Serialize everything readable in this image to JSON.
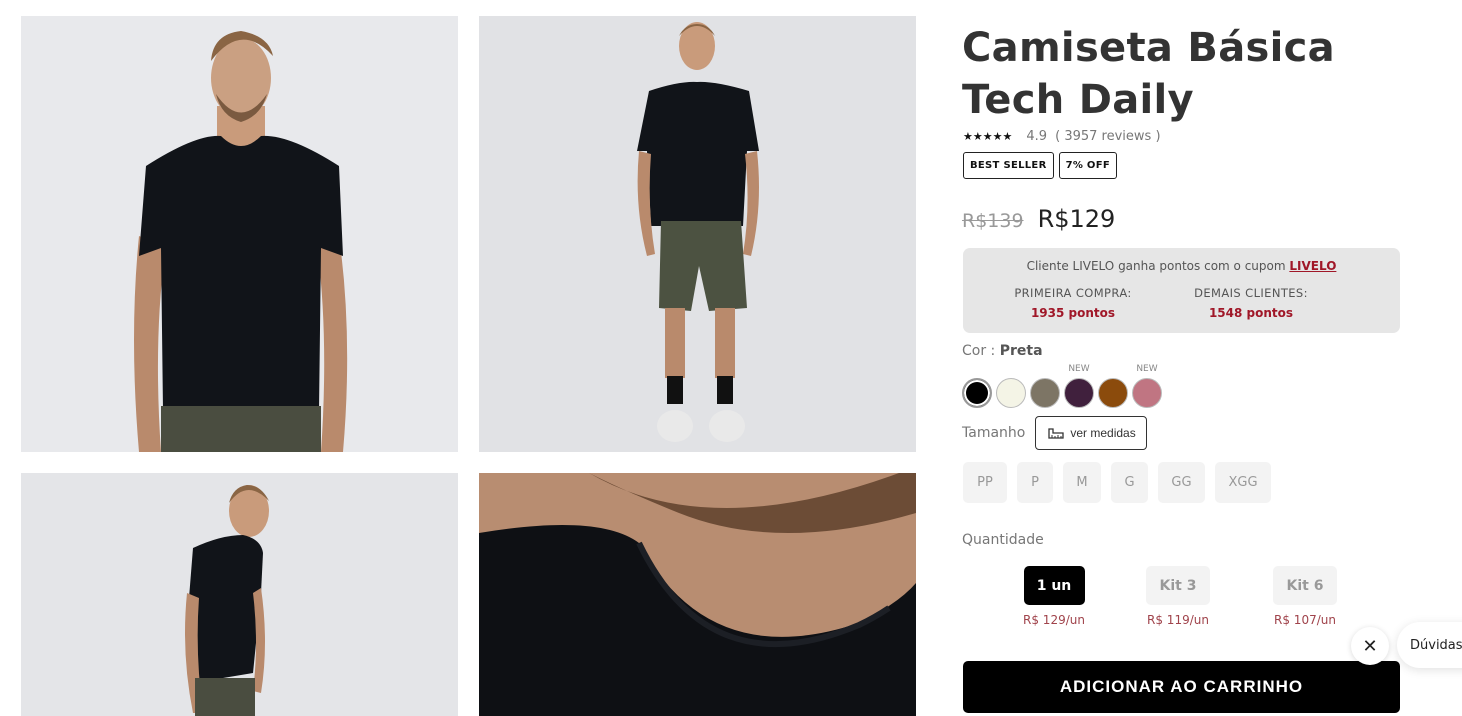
{
  "gallery": {
    "images": [
      "photo-front-upper",
      "photo-full-body",
      "photo-back-side",
      "photo-collar-closeup"
    ]
  },
  "product": {
    "title": "Camiseta Básica Tech Daily",
    "stars": "★★★★★",
    "rating": "4.9",
    "reviews": "( 3957 reviews )",
    "badges": [
      "BEST SELLER",
      "7% OFF"
    ],
    "old_price": "R$139",
    "price": "R$129"
  },
  "livelo": {
    "text": "Cliente LIVELO ganha pontos com o cupom",
    "coupon": "LIVELO",
    "first_label": "PRIMEIRA COMPRA:",
    "first_points": "1935 pontos",
    "other_label": "DEMAIS CLIENTES:",
    "other_points": "1548 pontos"
  },
  "color": {
    "label": "Cor :",
    "selected": "Preta",
    "swatches": [
      {
        "color": "#000000",
        "new": ""
      },
      {
        "color": "#f4f4e6",
        "new": ""
      },
      {
        "color": "#7d7565",
        "new": ""
      },
      {
        "color": "#40203d",
        "new": "NEW"
      },
      {
        "color": "#8b4b0c",
        "new": ""
      },
      {
        "color": "#c07582",
        "new": "NEW"
      }
    ]
  },
  "size": {
    "label": "Tamanho",
    "measure_button": "ver medidas",
    "options": [
      "PP",
      "P",
      "M",
      "G",
      "GG",
      "XGG"
    ]
  },
  "quantity": {
    "label": "Quantidade",
    "options": [
      {
        "label": "1 un",
        "price": "R$ 129/un"
      },
      {
        "label": "Kit 3",
        "price": "R$ 119/un"
      },
      {
        "label": "Kit 6",
        "price": "R$ 107/un"
      }
    ]
  },
  "cta": {
    "add_to_cart": "ADICIONAR AO CARRINHO"
  },
  "chat": {
    "close_icon": "✕",
    "help_label": "Dúvidas"
  }
}
